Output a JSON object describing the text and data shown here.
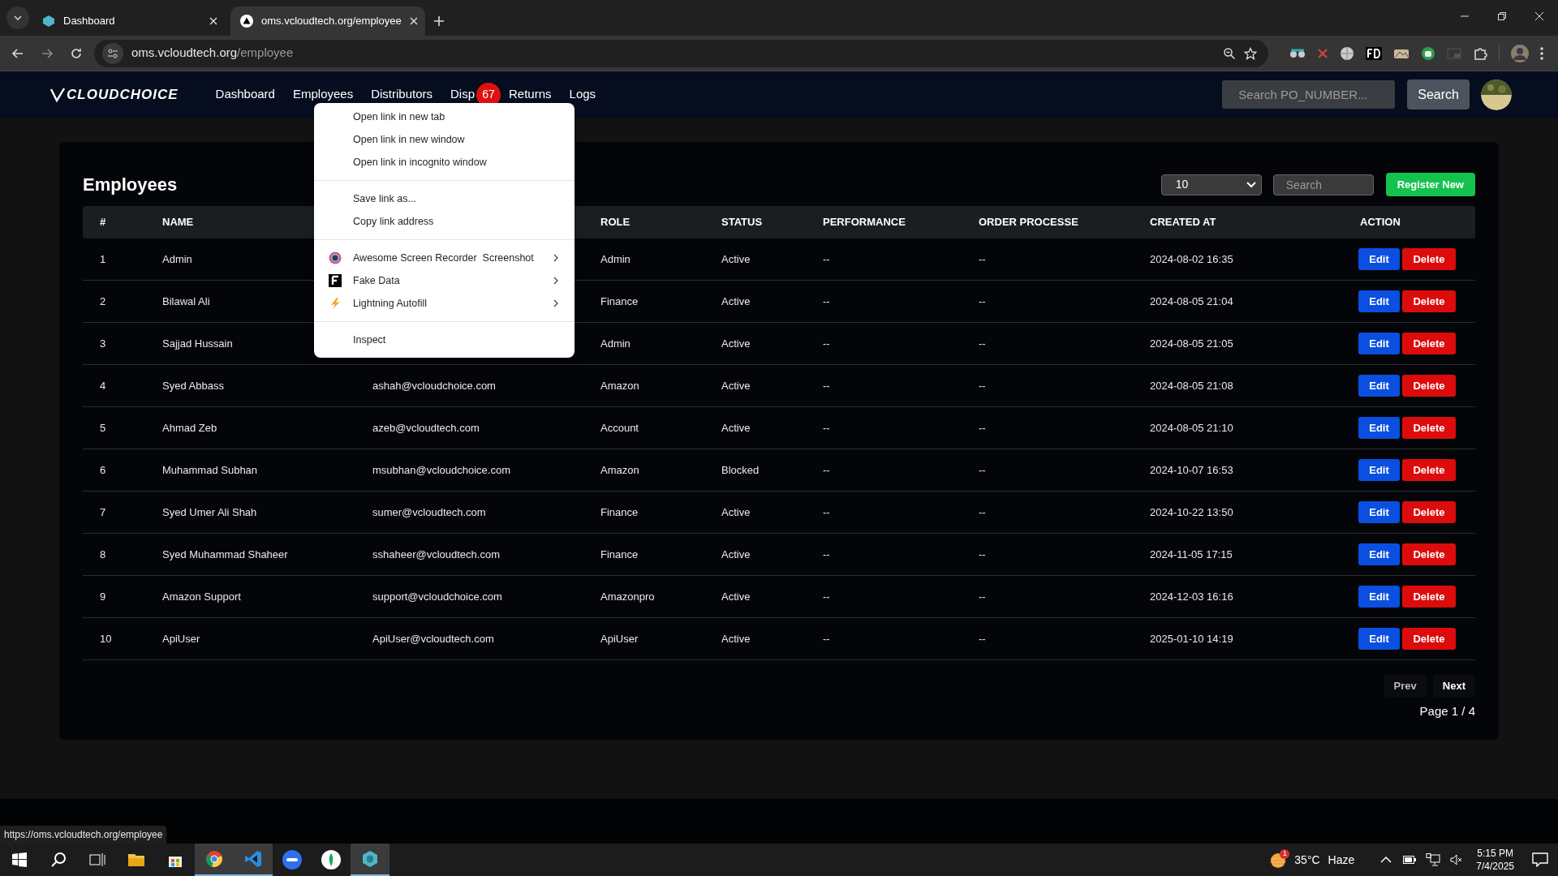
{
  "browser": {
    "tabs": [
      {
        "title": "Dashboard",
        "selected": false
      },
      {
        "title": "oms.vcloudtech.org/employee",
        "selected": true
      }
    ],
    "url_host": "oms.vcloudtech.org",
    "url_path": "/employee"
  },
  "navbar": {
    "logo": "CLOUDCHOICE",
    "links": [
      {
        "label": "Dashboard"
      },
      {
        "label": "Employees"
      },
      {
        "label": "Distributors"
      },
      {
        "label": "Disp",
        "badge": "67"
      },
      {
        "label": "Returns"
      },
      {
        "label": "Logs"
      }
    ],
    "search_placeholder": "Search PO_NUMBER...",
    "search_button": "Search"
  },
  "page": {
    "title": "Employees",
    "page_size": "10",
    "search_placeholder": "Search",
    "register_button": "Register New"
  },
  "table": {
    "header": {
      "number": "#",
      "name": "NAME",
      "role": "ROLE",
      "status": "STATUS",
      "performance": "PERFORMANCE",
      "orders": "ORDER PROCESSE",
      "created": "CREATED AT",
      "action": "ACTION"
    },
    "rows": [
      {
        "number": "1",
        "name": "Admin",
        "role": "Admin",
        "status": "Active",
        "performance": "--",
        "orders": "--",
        "created": "2024-08-02 16:35",
        "edit": "Edit",
        "delete": "Delete"
      },
      {
        "number": "2",
        "name": "Bilawal Ali",
        "role": "Finance",
        "status": "Active",
        "performance": "--",
        "orders": "--",
        "created": "2024-08-05 21:04",
        "edit": "Edit",
        "delete": "Delete"
      },
      {
        "number": "3",
        "name": "Sajjad Hussain",
        "role": "Admin",
        "status": "Active",
        "performance": "--",
        "orders": "--",
        "created": "2024-08-05 21:05",
        "edit": "Edit",
        "delete": "Delete"
      },
      {
        "number": "4",
        "name": "Syed Abbass",
        "email": "ashah@vcloudchoice.com",
        "role": "Amazon",
        "status": "Active",
        "performance": "--",
        "orders": "--",
        "created": "2024-08-05 21:08",
        "edit": "Edit",
        "delete": "Delete"
      },
      {
        "number": "5",
        "name": "Ahmad Zeb",
        "email": "azeb@vcloudtech.com",
        "role": "Account",
        "status": "Active",
        "performance": "--",
        "orders": "--",
        "created": "2024-08-05 21:10",
        "edit": "Edit",
        "delete": "Delete"
      },
      {
        "number": "6",
        "name": "Muhammad Subhan",
        "email": "msubhan@vcloudchoice.com",
        "role": "Amazon",
        "status": "Blocked",
        "performance": "--",
        "orders": "--",
        "created": "2024-10-07 16:53",
        "edit": "Edit",
        "delete": "Delete"
      },
      {
        "number": "7",
        "name": "Syed Umer Ali Shah",
        "email": "sumer@vcloudtech.com",
        "role": "Finance",
        "status": "Active",
        "performance": "--",
        "orders": "--",
        "created": "2024-10-22 13:50",
        "edit": "Edit",
        "delete": "Delete"
      },
      {
        "number": "8",
        "name": "Syed Muhammad Shaheer",
        "email": "sshaheer@vcloudtech.com",
        "role": "Finance",
        "status": "Active",
        "performance": "--",
        "orders": "--",
        "created": "2024-11-05 17:15",
        "edit": "Edit",
        "delete": "Delete"
      },
      {
        "number": "9",
        "name": "Amazon Support",
        "email": "support@vcloudchoice.com",
        "role": "Amazonpro",
        "status": "Active",
        "performance": "--",
        "orders": "--",
        "created": "2024-12-03 16:16",
        "edit": "Edit",
        "delete": "Delete"
      },
      {
        "number": "10",
        "name": "ApiUser",
        "email": "ApiUser@vcloudtech.com",
        "role": "ApiUser",
        "status": "Active",
        "performance": "--",
        "orders": "--",
        "created": "2025-01-10 14:19",
        "edit": "Edit",
        "delete": "Delete"
      }
    ]
  },
  "pagination": {
    "prev": "Prev",
    "next": "Next",
    "page_info": "Page 1 / 4"
  },
  "context_menu": {
    "groups": [
      [
        {
          "label": "Open link in new tab"
        },
        {
          "label": "Open link in new window"
        },
        {
          "label": "Open link in incognito window"
        }
      ],
      [
        {
          "label": "Save link as..."
        },
        {
          "label": "Copy link address"
        }
      ],
      [
        {
          "label": "Awesome Screen Recorder  Screenshot",
          "kind": "recorder",
          "submenu": true
        },
        {
          "label": "Fake Data",
          "kind": "fakedata",
          "submenu": true
        },
        {
          "label": "Lightning Autofill",
          "kind": "lightning",
          "submenu": true
        }
      ],
      [
        {
          "label": "Inspect"
        }
      ]
    ]
  },
  "status_url": "https://oms.vcloudtech.org/employee",
  "taskbar": {
    "weather": "35°C",
    "weather_text": "Haze",
    "weather_badge": "1",
    "time": "5:15 PM",
    "date": "7/4/2025"
  }
}
